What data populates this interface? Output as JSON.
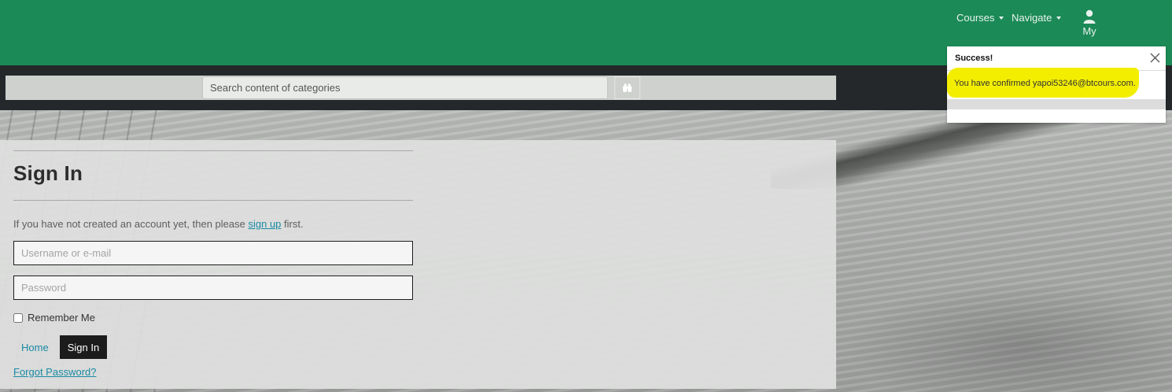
{
  "header": {
    "nav": [
      {
        "label": "Courses"
      },
      {
        "label": "Navigate"
      }
    ],
    "user": {
      "label": "My"
    }
  },
  "search": {
    "placeholder": "Search content of categories",
    "button_icon": "binoculars-icon"
  },
  "signin": {
    "title": "Sign In",
    "intro_before": "If you have not created an account yet, then please ",
    "signup_link": "sign up",
    "intro_after": " first.",
    "username_placeholder": "Username or e-mail",
    "password_placeholder": "Password",
    "remember_label": "Remember Me",
    "home_label": "Home",
    "signin_label": "Sign In",
    "forgot_label": "Forgot Password?"
  },
  "toast": {
    "title": "Success!",
    "message": "You have confirmed yapoi53246@btcours.com."
  },
  "colors": {
    "header": "#1b8a56",
    "dark_band": "#25282b",
    "link": "#1a8aa5",
    "highlight": "#f3ee00"
  }
}
